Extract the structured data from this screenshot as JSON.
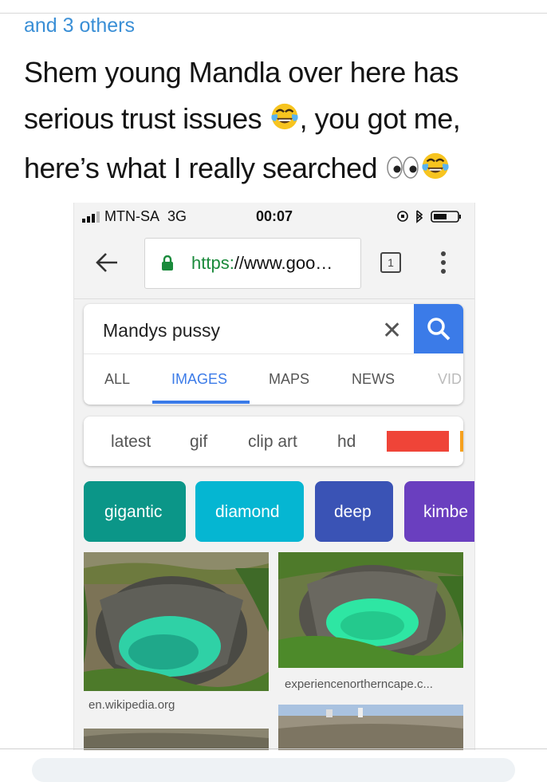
{
  "tweet": {
    "reply_context": "and 3 others",
    "lines": [
      "Shem young Mandla over here has",
      "serious trust issues",
      ", you got me,",
      "here’s what I really searched"
    ]
  },
  "phone": {
    "status_bar": {
      "carrier": "MTN-SA",
      "network": "3G",
      "time": "00:07"
    },
    "browser": {
      "url_scheme": "https:",
      "url_rest": "//www.goo…",
      "tab_count": "1"
    },
    "search": {
      "query": "Mandys pussy",
      "tabs": [
        "ALL",
        "IMAGES",
        "MAPS",
        "NEWS",
        "VID"
      ],
      "active_tab": "IMAGES"
    },
    "suggestion_chips": [
      "latest",
      "gif",
      "clip art",
      "hd"
    ],
    "related_pills": [
      {
        "label": "gigantic",
        "color": "#0b9688"
      },
      {
        "label": "diamond",
        "color": "#05b6d2"
      },
      {
        "label": "deep",
        "color": "#3a53b5"
      },
      {
        "label": "kimbe",
        "color": "#6a3fbf"
      }
    ],
    "results": [
      {
        "source": "en.wikipedia.org"
      },
      {
        "source": "experiencenortherncape.c..."
      }
    ]
  },
  "colors": {
    "link": "#3a8fd6",
    "google_blue": "#3b7be8",
    "secure_green": "#1a8a3b",
    "water": "#2fd1a6"
  }
}
